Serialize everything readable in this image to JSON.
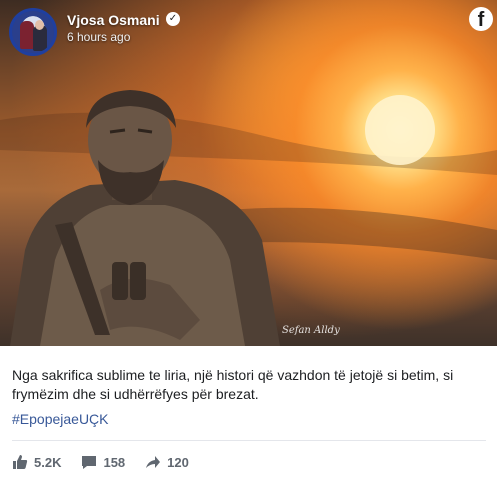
{
  "post": {
    "author": "Vjosa Osmani",
    "verified_icon": "verified-badge-icon",
    "timestamp": "6 hours ago",
    "platform_logo": "f",
    "photo_signature": "Sefan Alldy",
    "caption": "Nga sakrifica sublime te liria, një histori që vazhdon të jetojë si betim, si frymëzim dhe si udhërrëfyes për brezat.",
    "hashtag": "#EpopejaeUÇK",
    "stats": {
      "likes": "5.2K",
      "comments": "158",
      "shares": "120"
    }
  },
  "colors": {
    "hashtag": "#385898",
    "stats_text": "#606770",
    "divider": "#e4e6eb"
  }
}
